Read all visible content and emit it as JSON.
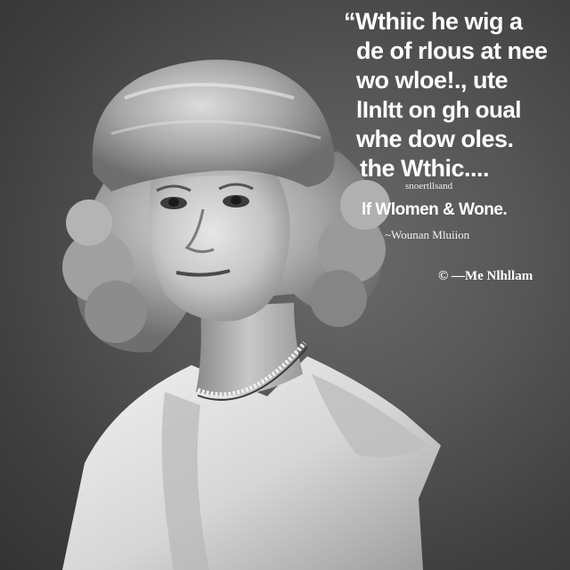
{
  "quote": {
    "lines": [
      "“Wthiic he wig a",
      "de of rlous at nee",
      "wo wloe!., ute",
      "lInltt on gh oual",
      "whe dow oles.",
      "the Wthic...."
    ]
  },
  "tagline": "snoertllsand",
  "subtitle": "lf Wlomen & Wone.",
  "author": "~Wounan Mluiion",
  "credit": "© —Me Nlhllam",
  "colors": {
    "background": "#4a4a4a",
    "text": "#ffffff"
  }
}
